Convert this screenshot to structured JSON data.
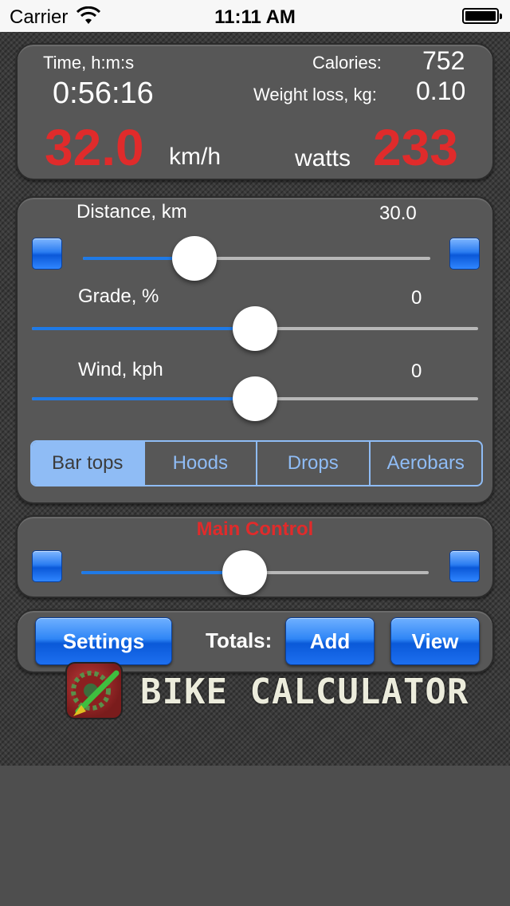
{
  "status_bar": {
    "carrier": "Carrier",
    "time": "11:11 AM"
  },
  "stats": {
    "time_label": "Time, h:m:s",
    "time_value": "0:56:16",
    "calories_label": "Calories:",
    "calories_value": "752",
    "weight_loss_label": "Weight loss, kg:",
    "weight_loss_value": "0.10",
    "speed_value": "32.0",
    "speed_unit": "km/h",
    "power_label": "watts",
    "power_value": "233"
  },
  "sliders": {
    "distance": {
      "label": "Distance, km",
      "value": "30.0",
      "level": 0.32
    },
    "grade": {
      "label": "Grade, %",
      "value": "0",
      "level": 0.5
    },
    "wind": {
      "label": "Wind, kph",
      "value": "0",
      "level": 0.5
    },
    "main": {
      "label": "Main Control",
      "level": 0.47
    }
  },
  "positions": {
    "items": [
      "Bar tops",
      "Hoods",
      "Drops",
      "Aerobars"
    ],
    "selected": "Bar tops"
  },
  "buttons": {
    "settings": "Settings",
    "totals_label": "Totals:",
    "add": "Add",
    "view": "View"
  },
  "logo": {
    "text": "BIKE CALCULATOR"
  },
  "colors": {
    "accent_red": "#e02b2b",
    "accent_blue": "#1f7ae6",
    "segment_blue": "#8fbcf5"
  },
  "icons": {
    "wifi": "wifi-icon",
    "battery": "battery-icon",
    "app": "bike-gear-icon"
  }
}
